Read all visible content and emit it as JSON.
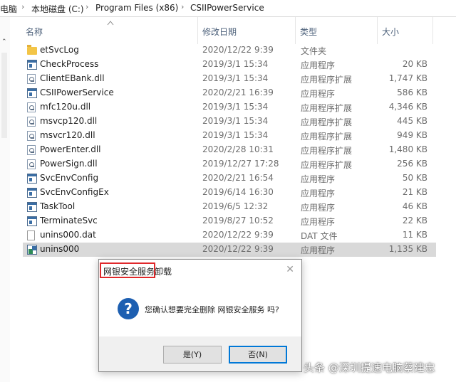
{
  "breadcrumbs": [
    "电脑",
    "本地磁盘 (C:)",
    "Program Files (x86)",
    "CSIIPowerService"
  ],
  "columns": {
    "name": "名称",
    "date": "修改日期",
    "type": "类型",
    "size": "大小"
  },
  "files": [
    {
      "name": "etSvcLog",
      "date": "2020/12/22 9:39",
      "type": "文件夹",
      "size": "",
      "icon": "folder-icon"
    },
    {
      "name": "CheckProcess",
      "date": "2019/3/1 15:34",
      "type": "应用程序",
      "size": "20 KB",
      "icon": "exe-icon"
    },
    {
      "name": "ClientEBank.dll",
      "date": "2019/3/1 15:34",
      "type": "应用程序扩展",
      "size": "1,747 KB",
      "icon": "dll-icon"
    },
    {
      "name": "CSIIPowerService",
      "date": "2020/2/21 16:39",
      "type": "应用程序",
      "size": "586 KB",
      "icon": "exe-icon"
    },
    {
      "name": "mfc120u.dll",
      "date": "2019/3/1 15:34",
      "type": "应用程序扩展",
      "size": "4,346 KB",
      "icon": "dll-icon"
    },
    {
      "name": "msvcp120.dll",
      "date": "2019/3/1 15:34",
      "type": "应用程序扩展",
      "size": "445 KB",
      "icon": "dll-icon"
    },
    {
      "name": "msvcr120.dll",
      "date": "2019/3/1 15:34",
      "type": "应用程序扩展",
      "size": "949 KB",
      "icon": "dll-icon"
    },
    {
      "name": "PowerEnter.dll",
      "date": "2020/2/28 10:31",
      "type": "应用程序扩展",
      "size": "1,480 KB",
      "icon": "dll-icon"
    },
    {
      "name": "PowerSign.dll",
      "date": "2019/12/27 17:28",
      "type": "应用程序扩展",
      "size": "256 KB",
      "icon": "dll-icon"
    },
    {
      "name": "SvcEnvConfig",
      "date": "2020/2/21 16:54",
      "type": "应用程序",
      "size": "50 KB",
      "icon": "exe-icon"
    },
    {
      "name": "SvcEnvConfigEx",
      "date": "2019/6/14 16:30",
      "type": "应用程序",
      "size": "21 KB",
      "icon": "exe-icon"
    },
    {
      "name": "TaskTool",
      "date": "2019/6/5 12:32",
      "type": "应用程序",
      "size": "46 KB",
      "icon": "exe-icon"
    },
    {
      "name": "TerminateSvc",
      "date": "2019/8/27 10:52",
      "type": "应用程序",
      "size": "22 KB",
      "icon": "exe-icon"
    },
    {
      "name": "unins000.dat",
      "date": "2020/12/22 9:39",
      "type": "DAT 文件",
      "size": "11 KB",
      "icon": "dat-file-icon"
    },
    {
      "name": "unins000",
      "date": "2020/12/22 9:39",
      "type": "应用程序",
      "size": "1,135 KB",
      "icon": "uninstaller-icon"
    }
  ],
  "dialog": {
    "title_highlight": "网银安全服务",
    "title_rest": "卸载",
    "message": "您确认想要完全删除 网银安全服务 吗?",
    "yes_label": "是(Y)",
    "no_label": "否(N)",
    "icon": "question-icon",
    "close_icon": "close-icon"
  },
  "watermark": "头条 @深圳提速电脑蔡建忠",
  "colors": {
    "highlight": "#e0282b",
    "selected_row": "#d9d9d9",
    "header_text": "#4c607a",
    "focus_border": "#0078d7"
  }
}
